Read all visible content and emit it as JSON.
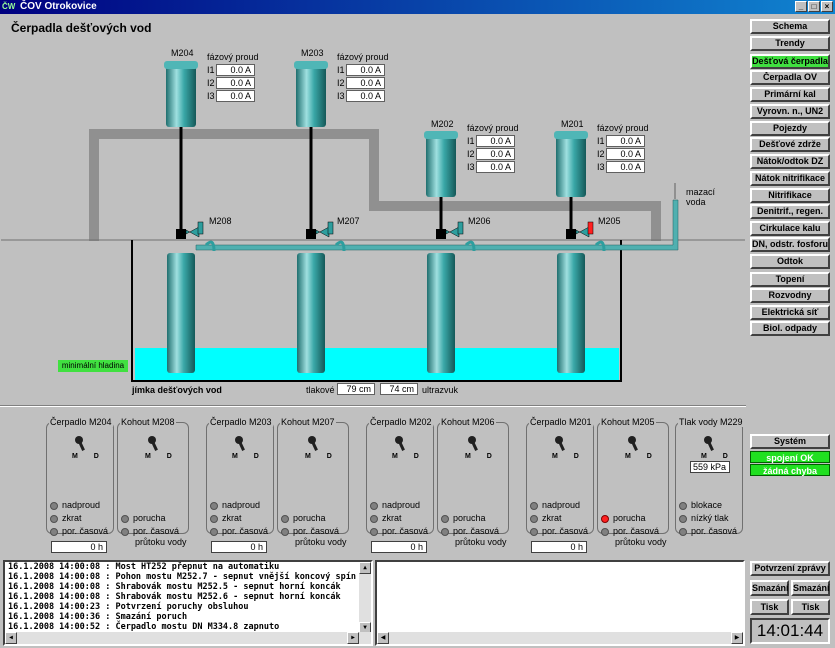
{
  "window": {
    "title": "ČOV Otrokovice",
    "app_icon": "ČW"
  },
  "page_title": "Čerpadla dešťových vod",
  "phase_label": "fázový proud",
  "motors": [
    {
      "name": "M204",
      "i1": "0.0 A",
      "i2": "0.0 A",
      "i3": "0.0 A"
    },
    {
      "name": "M203",
      "i1": "0.0 A",
      "i2": "0.0 A",
      "i3": "0.0 A"
    },
    {
      "name": "M202",
      "i1": "0.0 A",
      "i2": "0.0 A",
      "i3": "0.0 A"
    },
    {
      "name": "M201",
      "i1": "0.0 A",
      "i2": "0.0 A",
      "i3": "0.0 A"
    }
  ],
  "phase_names": [
    "I1",
    "I2",
    "I3"
  ],
  "valves": [
    "M208",
    "M207",
    "M206",
    "M205"
  ],
  "lubricating_water": [
    "mazací",
    "voda"
  ],
  "min_level": "minimální hladina",
  "sump_label": "jímka dešťových vod",
  "pressure_label": "tlakové",
  "pressure_value": "79 cm",
  "ultrasound_value": "74 cm",
  "ultrasound_label": "ultrazvuk",
  "nav": {
    "items": [
      "Schema",
      "Trendy",
      "Dešťová čerpadla",
      "Čerpadla OV",
      "Primární kal",
      "Vyrovn. n., UN2",
      "Pojezdy",
      "Dešťové zdrže",
      "Nátok/odtok DZ",
      "Nátok nitrifikace",
      "Nitrifikace",
      "Denitrif., regen.",
      "Cirkulace kalu",
      "DN, odstr. fosforu",
      "Odtok",
      "Topení",
      "Rozvodny",
      "Elektrická síť",
      "Biol. odpady"
    ],
    "system": "Systém",
    "status1": "spojení OK",
    "status2": "žádná chyba",
    "confirm": "Potvrzení zprávy",
    "delete1": "Smazání",
    "delete2": "Smazání",
    "print1": "Tisk",
    "print2": "Tisk",
    "clock": "14:01:44"
  },
  "panels": {
    "pump_titles": [
      "Čerpadlo M204",
      "Čerpadlo M203",
      "Čerpadlo M202",
      "Čerpadlo M201"
    ],
    "valve_titles": [
      "Kohout M208",
      "Kohout M207",
      "Kohout M206",
      "Kohout M205"
    ],
    "pressure_title": "Tlak vody M229",
    "md": "M D",
    "overcurrent": "nadproud",
    "short": "zkrat",
    "timeout": "por. časová",
    "hours": "0 h",
    "fault": "porucha",
    "flow_timeout_1": "por. časová",
    "flow_timeout_2": "průtoku vody",
    "pressure_value": "559 kPa",
    "block": "blokace",
    "low_pressure": "nízký tlak",
    "pressure_timeout": "por. časová"
  },
  "log": [
    "16.1.2008 14:00:08 : Most HT252 přepnut na automatiku",
    "16.1.2008 14:00:08 : Pohon mostu M252.7 - sepnut vnější koncový spín",
    "16.1.2008 14:00:08 : Shrabovák mostu M252.5 - sepnut horní koncák",
    "16.1.2008 14:00:08 : Shrabovák mostu M252.6 - sepnut horní koncák",
    "16.1.2008 14:00:23 : Potvrzení poruchy obsluhou",
    "16.1.2008 14:00:36 : Smazání poruch",
    "16.1.2008 14:00:52 : Čerpadlo mostu DN M334.8 zapnuto"
  ],
  "colors": {
    "water": "#00ffff",
    "pump": "#2e9e9e",
    "active": "#40e040",
    "fault": "#ff2020"
  }
}
